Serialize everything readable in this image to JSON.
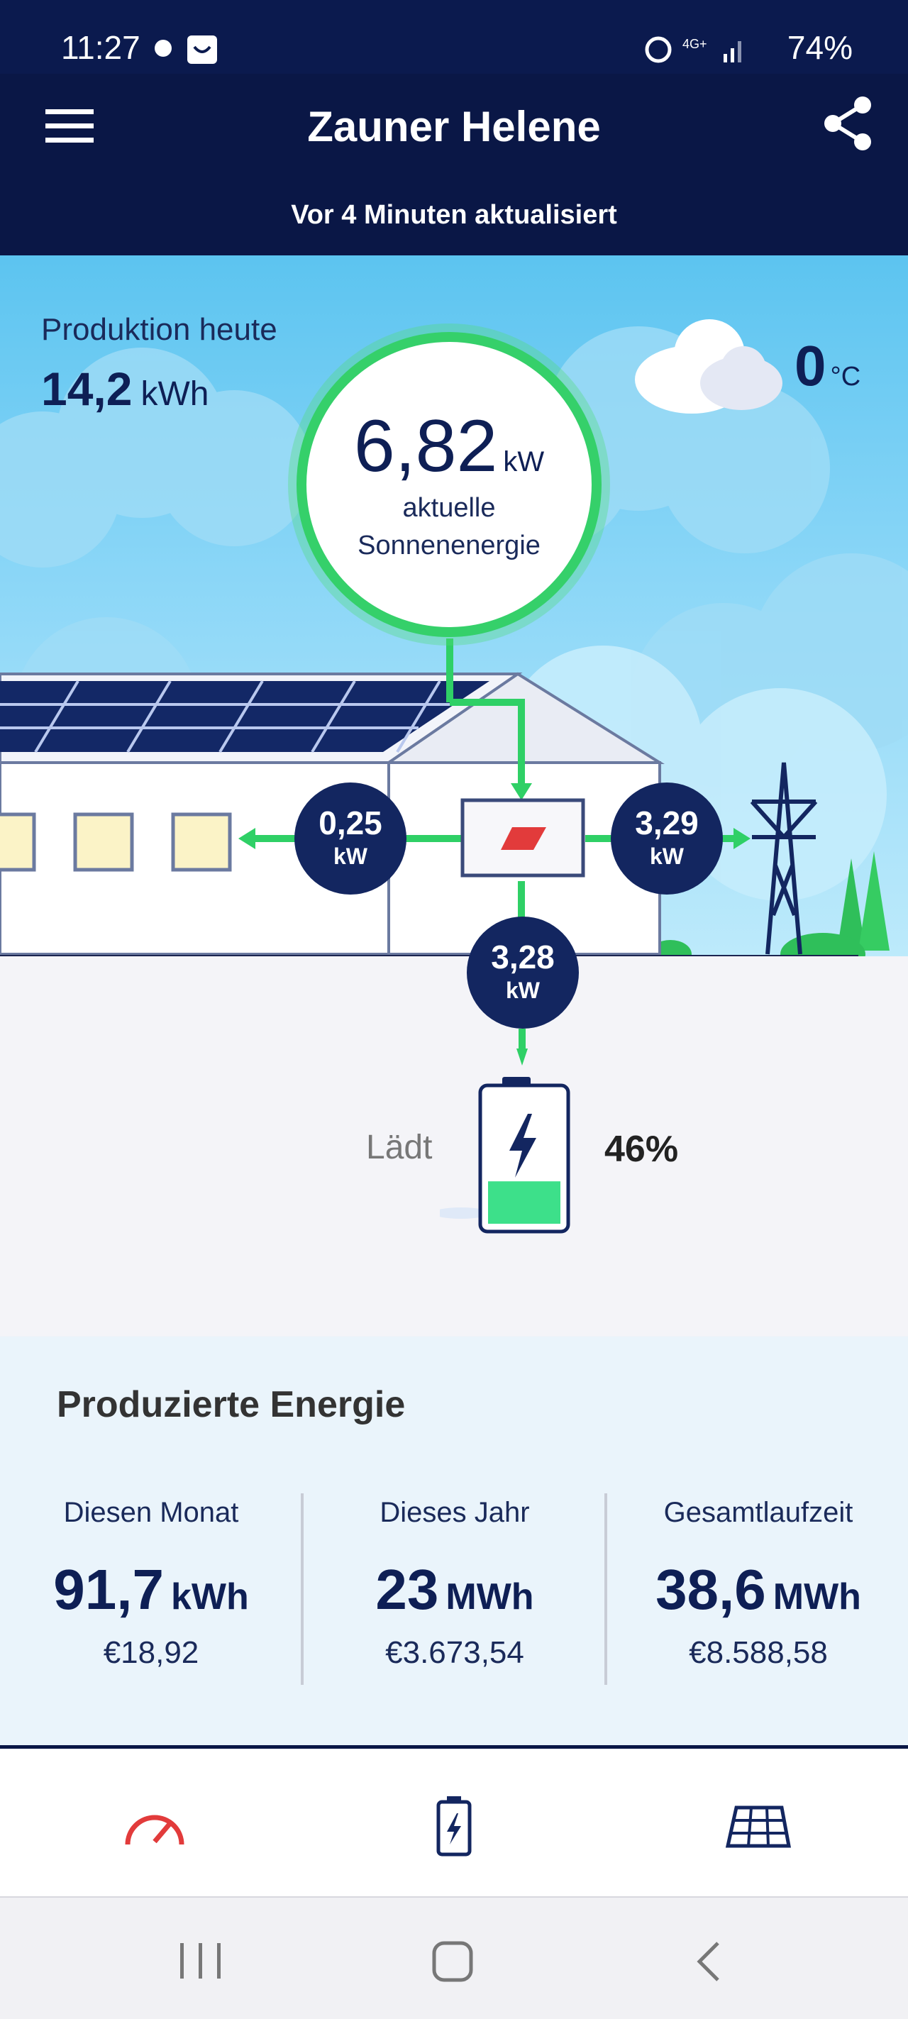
{
  "status_bar": {
    "time": "11:27",
    "network": "4G+",
    "battery": "74%"
  },
  "header": {
    "title": "Zauner Helene",
    "subtitle": "Vor 4 Minuten aktualisiert"
  },
  "production": {
    "label": "Produktion heute",
    "value": "14,2",
    "unit": "kWh"
  },
  "weather": {
    "temperature": "0",
    "unit": "°C"
  },
  "solar": {
    "value": "6,82",
    "unit": "kW",
    "label_line1": "aktuelle",
    "label_line2": "Sonnenenergie"
  },
  "flows": {
    "home": {
      "value": "0,25",
      "unit": "kW"
    },
    "grid": {
      "value": "3,29",
      "unit": "kW"
    },
    "battery": {
      "value": "3,28",
      "unit": "kW"
    }
  },
  "battery": {
    "status": "Lädt",
    "level": "46%",
    "level_fraction": 0.46
  },
  "stats": {
    "title": "Produzierte Energie",
    "columns": [
      {
        "heading": "Diesen Monat",
        "value": "91,7",
        "unit": "kWh",
        "euro": "€18,92"
      },
      {
        "heading": "Dieses Jahr",
        "value": "23",
        "unit": "MWh",
        "euro": "€3.673,54"
      },
      {
        "heading": "Gesamtlaufzeit",
        "value": "38,6",
        "unit": "MWh",
        "euro": "€8.588,58"
      }
    ]
  },
  "tabs": [
    "gauge-icon",
    "battery-icon",
    "solar-panel-icon"
  ],
  "colors": {
    "navy": "#0a1746",
    "green": "#35d06a",
    "red": "#e23b3b"
  }
}
